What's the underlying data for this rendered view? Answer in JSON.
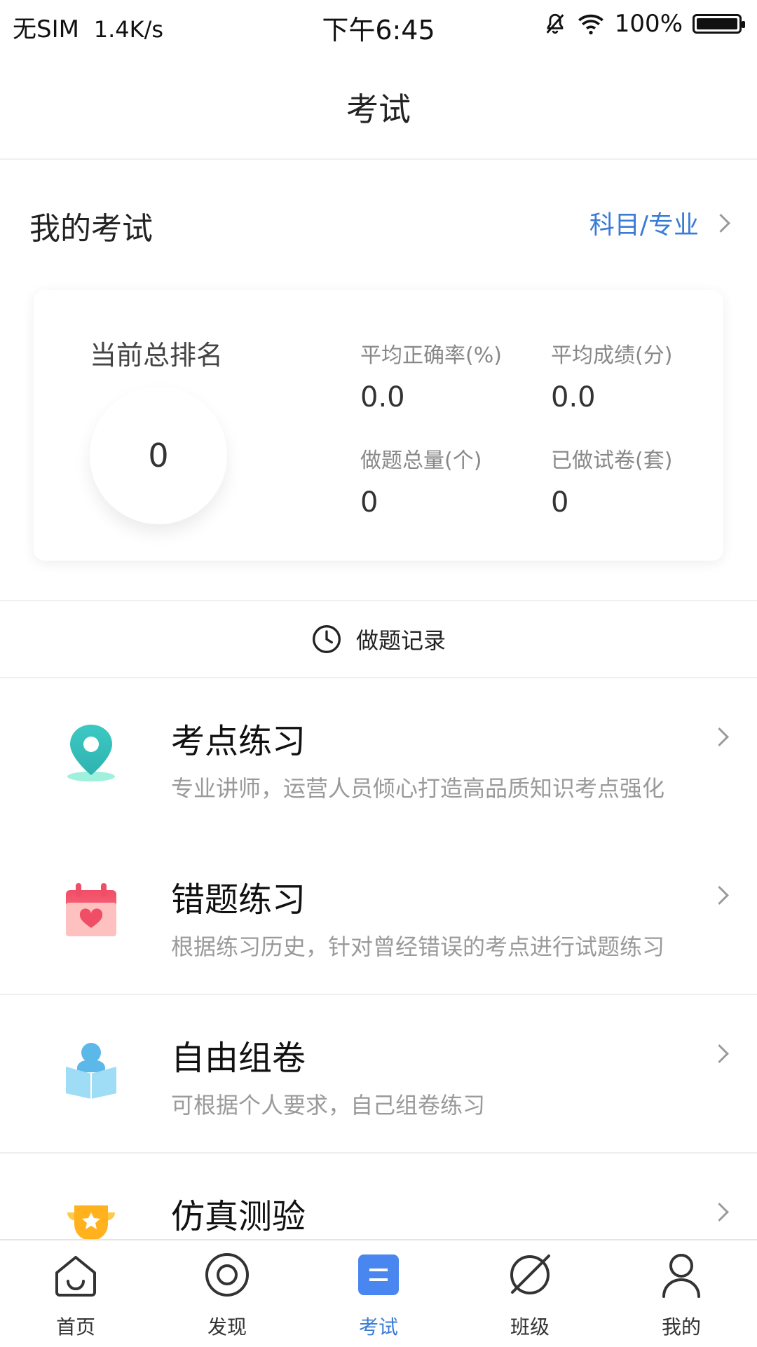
{
  "status_bar": {
    "carrier": "无SIM",
    "speed": "1.4K/s",
    "time": "下午6:45",
    "battery": "100%",
    "battery_level": 1.0
  },
  "header": {
    "title": "考试"
  },
  "my_exam": {
    "title": "我的考试",
    "subject_link": "科目/专业"
  },
  "stats": {
    "rank_label": "当前总排名",
    "rank_value": "0",
    "metrics": [
      {
        "label": "平均正确率(%)",
        "value": "0.0"
      },
      {
        "label": "平均成绩(分)",
        "value": "0.0"
      },
      {
        "label": "做题总量(个)",
        "value": "0"
      },
      {
        "label": "已做试卷(套)",
        "value": "0"
      }
    ]
  },
  "record": {
    "label": "做题记录"
  },
  "items": [
    {
      "title": "考点练习",
      "desc": "专业讲师，运营人员倾心打造高品质知识考点强化",
      "icon": "location-pin-icon"
    },
    {
      "title": "错题练习",
      "desc": "根据练习历史，针对曾经错误的考点进行试题练习",
      "icon": "calendar-heart-icon"
    },
    {
      "title": "自由组卷",
      "desc": "可根据个人要求，自己组卷练习",
      "icon": "reader-book-icon"
    },
    {
      "title": "仿真测验",
      "desc": "",
      "icon": "trophy-icon"
    }
  ],
  "bottom_nav": [
    {
      "label": "首页",
      "icon": "home-icon"
    },
    {
      "label": "发现",
      "icon": "discover-icon"
    },
    {
      "label": "考试",
      "icon": "exam-icon",
      "active": true
    },
    {
      "label": "班级",
      "icon": "planet-icon"
    },
    {
      "label": "我的",
      "icon": "profile-icon"
    }
  ],
  "colors": {
    "accent": "#3a7bd5",
    "muted_text": "#9a9a9a",
    "teal": "#2ec4b6",
    "red": "#f25b6b"
  }
}
